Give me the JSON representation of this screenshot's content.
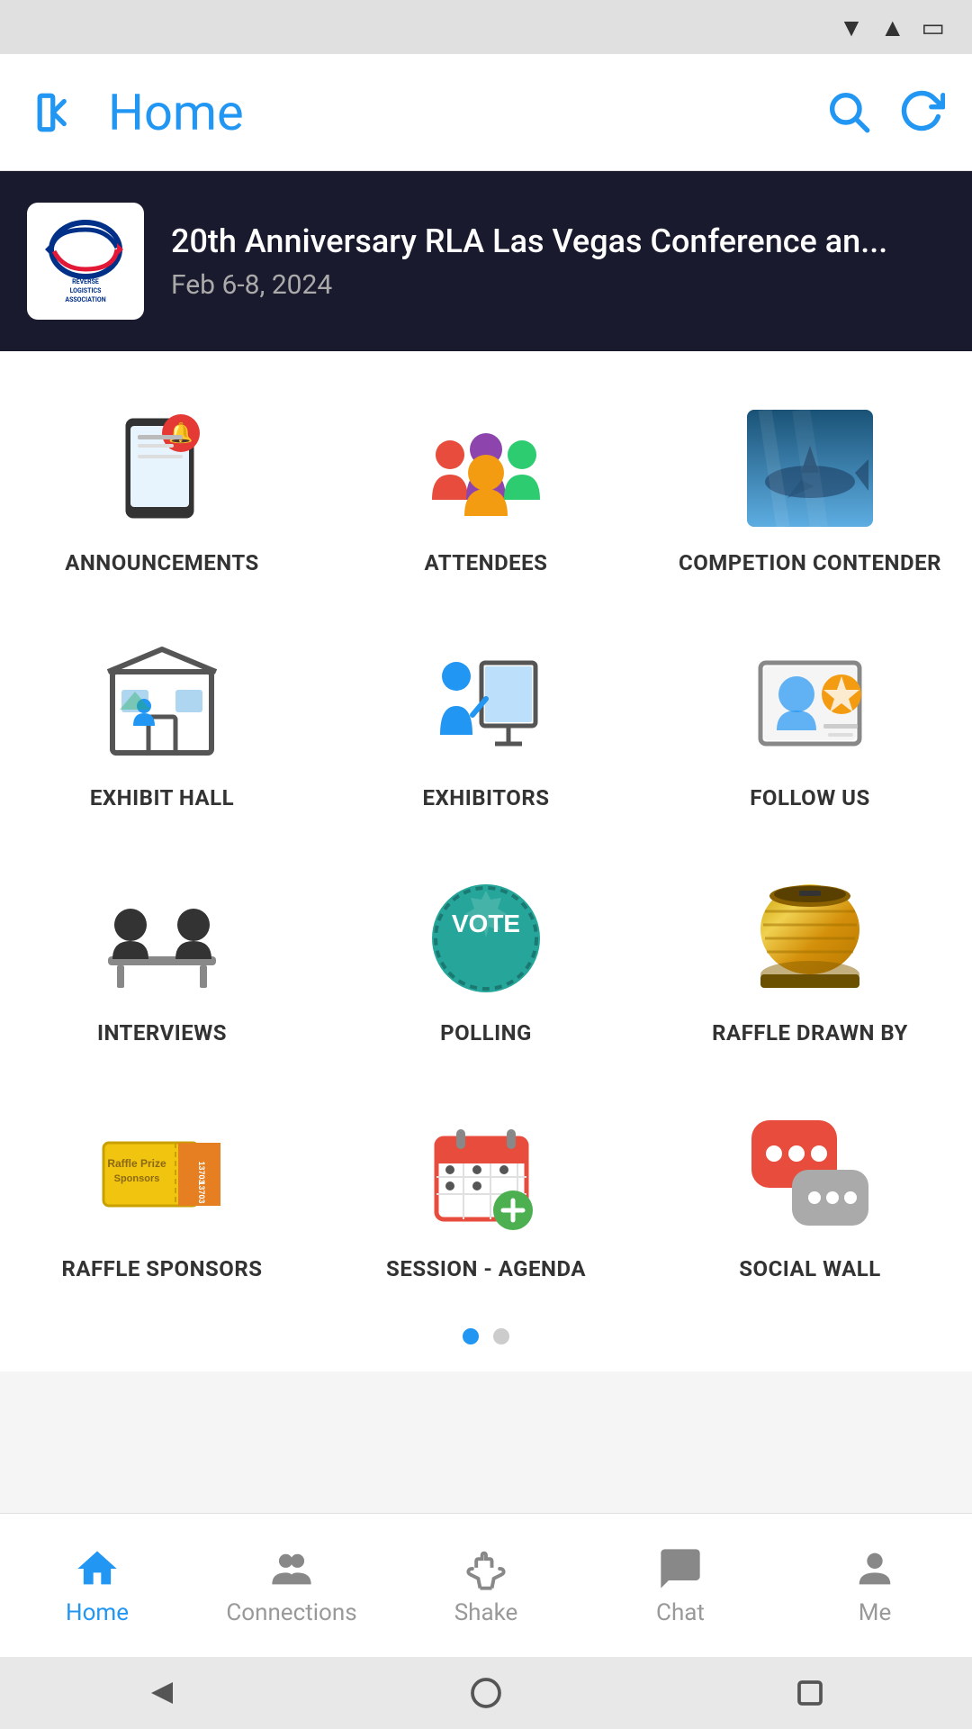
{
  "statusBar": {
    "wifiIcon": "wifi",
    "signalIcon": "signal",
    "batteryIcon": "battery"
  },
  "topBar": {
    "backLabel": "back",
    "title": "Home",
    "searchLabel": "search",
    "refreshLabel": "refresh"
  },
  "eventBanner": {
    "title": "20th Anniversary RLA Las Vegas Conference an...",
    "date": "Feb 6-8, 2024",
    "orgName": "REVERSE LOGISTICS ASSOCIATION"
  },
  "gridItems": [
    {
      "id": "announcements",
      "label": "ANNOUNCEMENTS",
      "iconType": "announce"
    },
    {
      "id": "attendees",
      "label": "ATTENDEES",
      "iconType": "attendees"
    },
    {
      "id": "competition-contender",
      "label": "COMPETION CONTENDER",
      "iconType": "shark"
    },
    {
      "id": "exhibit-hall",
      "label": "EXHIBIT HALL",
      "iconType": "exhibit"
    },
    {
      "id": "exhibitors",
      "label": "EXHIBITORS",
      "iconType": "exhibitors"
    },
    {
      "id": "follow-us",
      "label": "FOLLOW US",
      "iconType": "followus"
    },
    {
      "id": "interviews",
      "label": "INTERVIEWS",
      "iconType": "interviews"
    },
    {
      "id": "polling",
      "label": "POLLING",
      "iconType": "vote"
    },
    {
      "id": "raffle-drawn",
      "label": "RAFFLE DRAWN BY",
      "iconType": "drum"
    },
    {
      "id": "raffle-sponsors",
      "label": "RAFFLE SPONSORS",
      "iconType": "ticket"
    },
    {
      "id": "session-agenda",
      "label": "SESSION - AGENDA",
      "iconType": "calendar"
    },
    {
      "id": "social-wall",
      "label": "SOCIAL WALL",
      "iconType": "socialwall"
    }
  ],
  "pageDots": [
    {
      "active": true
    },
    {
      "active": false
    }
  ],
  "bottomNav": [
    {
      "id": "home",
      "label": "Home",
      "active": true,
      "iconType": "home"
    },
    {
      "id": "connections",
      "label": "Connections",
      "active": false,
      "iconType": "connections"
    },
    {
      "id": "shake",
      "label": "Shake",
      "active": false,
      "iconType": "shake"
    },
    {
      "id": "chat",
      "label": "Chat",
      "active": false,
      "iconType": "chat"
    },
    {
      "id": "me",
      "label": "Me",
      "active": false,
      "iconType": "me"
    }
  ]
}
